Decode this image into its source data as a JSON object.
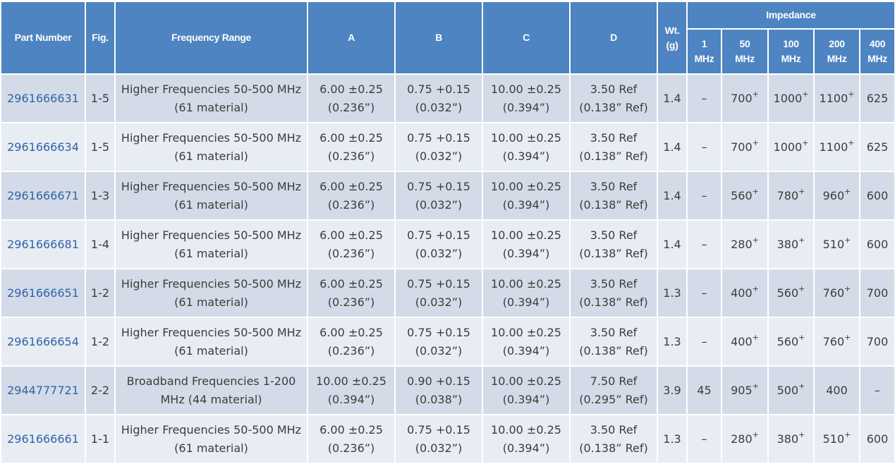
{
  "headers": {
    "part_number": "Part Number",
    "fig": "Fig.",
    "frequency_range": "Frequency Range",
    "a": "A",
    "b": "B",
    "c": "C",
    "d": "D",
    "wt_line1": "Wt.",
    "wt_line2": "(g)",
    "impedance": "Impedance",
    "imp": [
      {
        "top": "1",
        "bottom": "MHz"
      },
      {
        "top": "50",
        "bottom": "MHz"
      },
      {
        "top": "100",
        "bottom": "MHz"
      },
      {
        "top": "200",
        "bottom": "MHz"
      },
      {
        "top": "400",
        "bottom": "MHz"
      }
    ]
  },
  "rows": [
    {
      "pn": "2961666631",
      "fig": "1-5",
      "freq1": "Higher Frequencies 50-500 MHz",
      "freq2": "(61 material)",
      "a1": "6.00 ±0.25",
      "a2": "(0.236”)",
      "b1": "0.75 +0.15",
      "b2": "(0.032”)",
      "c1": "10.00 ±0.25",
      "c2": "(0.394”)",
      "d1": "3.50 Ref",
      "d2": "(0.138” Ref)",
      "wt": "1.4",
      "i1": "–",
      "i50": "700",
      "i50s": "+",
      "i100": "1000",
      "i100s": "+",
      "i200": "1100",
      "i200s": "+",
      "i400": "625",
      "i400s": ""
    },
    {
      "pn": "2961666634",
      "fig": "1-5",
      "freq1": "Higher Frequencies 50-500 MHz",
      "freq2": "(61 material)",
      "a1": "6.00 ±0.25",
      "a2": "(0.236”)",
      "b1": "0.75 +0.15",
      "b2": "(0.032”)",
      "c1": "10.00 ±0.25",
      "c2": "(0.394”)",
      "d1": "3.50 Ref",
      "d2": "(0.138” Ref)",
      "wt": "1.4",
      "i1": "–",
      "i50": "700",
      "i50s": "+",
      "i100": "1000",
      "i100s": "+",
      "i200": "1100",
      "i200s": "+",
      "i400": "625",
      "i400s": ""
    },
    {
      "pn": "2961666671",
      "fig": "1-3",
      "freq1": "Higher Frequencies 50-500 MHz",
      "freq2": "(61 material)",
      "a1": "6.00 ±0.25",
      "a2": "(0.236”)",
      "b1": "0.75 +0.15",
      "b2": "(0.032”)",
      "c1": "10.00 ±0.25",
      "c2": "(0.394”)",
      "d1": "3.50 Ref",
      "d2": "(0.138” Ref)",
      "wt": "1.4",
      "i1": "–",
      "i50": "560",
      "i50s": "+",
      "i100": "780",
      "i100s": "+",
      "i200": "960",
      "i200s": "+",
      "i400": "600",
      "i400s": ""
    },
    {
      "pn": "2961666681",
      "fig": "1-4",
      "freq1": "Higher Frequencies 50-500 MHz",
      "freq2": "(61 material)",
      "a1": "6.00 ±0.25",
      "a2": "(0.236”)",
      "b1": "0.75 +0.15",
      "b2": "(0.032”)",
      "c1": "10.00 ±0.25",
      "c2": "(0.394”)",
      "d1": "3.50 Ref",
      "d2": "(0.138” Ref)",
      "wt": "1.4",
      "i1": "–",
      "i50": "280",
      "i50s": "+",
      "i100": "380",
      "i100s": "+",
      "i200": "510",
      "i200s": "+",
      "i400": "600",
      "i400s": ""
    },
    {
      "pn": "2961666651",
      "fig": "1-2",
      "freq1": "Higher Frequencies 50-500 MHz",
      "freq2": "(61 material)",
      "a1": "6.00 ±0.25",
      "a2": "(0.236”)",
      "b1": "0.75 +0.15",
      "b2": "(0.032”)",
      "c1": "10.00 ±0.25",
      "c2": "(0.394”)",
      "d1": "3.50 Ref",
      "d2": "(0.138” Ref)",
      "wt": "1.3",
      "i1": "–",
      "i50": "400",
      "i50s": "+",
      "i100": "560",
      "i100s": "+",
      "i200": "760",
      "i200s": "+",
      "i400": "700",
      "i400s": ""
    },
    {
      "pn": "2961666654",
      "fig": "1-2",
      "freq1": "Higher Frequencies 50-500 MHz",
      "freq2": "(61 material)",
      "a1": "6.00 ±0.25",
      "a2": "(0.236”)",
      "b1": "0.75 +0.15",
      "b2": "(0.032”)",
      "c1": "10.00 ±0.25",
      "c2": "(0.394”)",
      "d1": "3.50 Ref",
      "d2": "(0.138” Ref)",
      "wt": "1.3",
      "i1": "–",
      "i50": "400",
      "i50s": "+",
      "i100": "560",
      "i100s": "+",
      "i200": "760",
      "i200s": "+",
      "i400": "700",
      "i400s": ""
    },
    {
      "pn": "2944777721",
      "fig": "2-2",
      "freq1": "Broadband Frequencies 1-200",
      "freq2": "MHz (44 material)",
      "a1": "10.00 ±0.25",
      "a2": "(0.394”)",
      "b1": "0.90 +0.15",
      "b2": "(0.038”)",
      "c1": "10.00 ±0.25",
      "c2": "(0.394”)",
      "d1": "7.50 Ref",
      "d2": "(0.295” Ref)",
      "wt": "3.9",
      "i1": "45",
      "i50": "905",
      "i50s": "+",
      "i100": "500",
      "i100s": "+",
      "i200": "400",
      "i200s": "",
      "i400": "–",
      "i400s": ""
    },
    {
      "pn": "2961666661",
      "fig": "1-1",
      "freq1": "Higher Frequencies 50-500 MHz",
      "freq2": "(61 material)",
      "a1": "6.00 ±0.25",
      "a2": "(0.236”)",
      "b1": "0.75 +0.15",
      "b2": "(0.032”)",
      "c1": "10.00 ±0.25",
      "c2": "(0.394”)",
      "d1": "3.50 Ref",
      "d2": "(0.138” Ref)",
      "wt": "1.3",
      "i1": "–",
      "i50": "280",
      "i50s": "+",
      "i100": "380",
      "i100s": "+",
      "i200": "510",
      "i200s": "+",
      "i400": "600",
      "i400s": ""
    }
  ]
}
